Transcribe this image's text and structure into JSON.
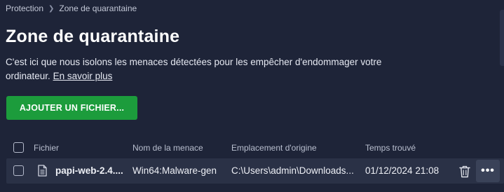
{
  "breadcrumb": {
    "parent": "Protection",
    "current": "Zone de quarantaine"
  },
  "page": {
    "title": "Zone de quarantaine",
    "description": "C'est ici que nous isolons les menaces détectées pour les empêcher d'endommager votre ordinateur.",
    "learn_more": "En savoir plus"
  },
  "actions": {
    "add_file": "AJOUTER UN FICHIER..."
  },
  "table": {
    "headers": {
      "file": "Fichier",
      "threat_name": "Nom de la menace",
      "origin": "Emplacement d'origine",
      "time_found": "Temps trouvé"
    },
    "rows": [
      {
        "file": "papi-web-2.4....",
        "threat_name": "Win64:Malware-gen",
        "origin": "C:\\Users\\admin\\Downloads...",
        "time_found": "01/12/2024 21:08",
        "more_label": "•••"
      }
    ]
  },
  "colors": {
    "background": "#1e2438",
    "row_background": "#2a3146",
    "accent_green": "#1c9c3c"
  },
  "icons": {
    "breadcrumb_separator": "chevron-right-icon",
    "file": "file-icon",
    "delete": "trash-icon",
    "more": "more-horizontal-icon"
  }
}
